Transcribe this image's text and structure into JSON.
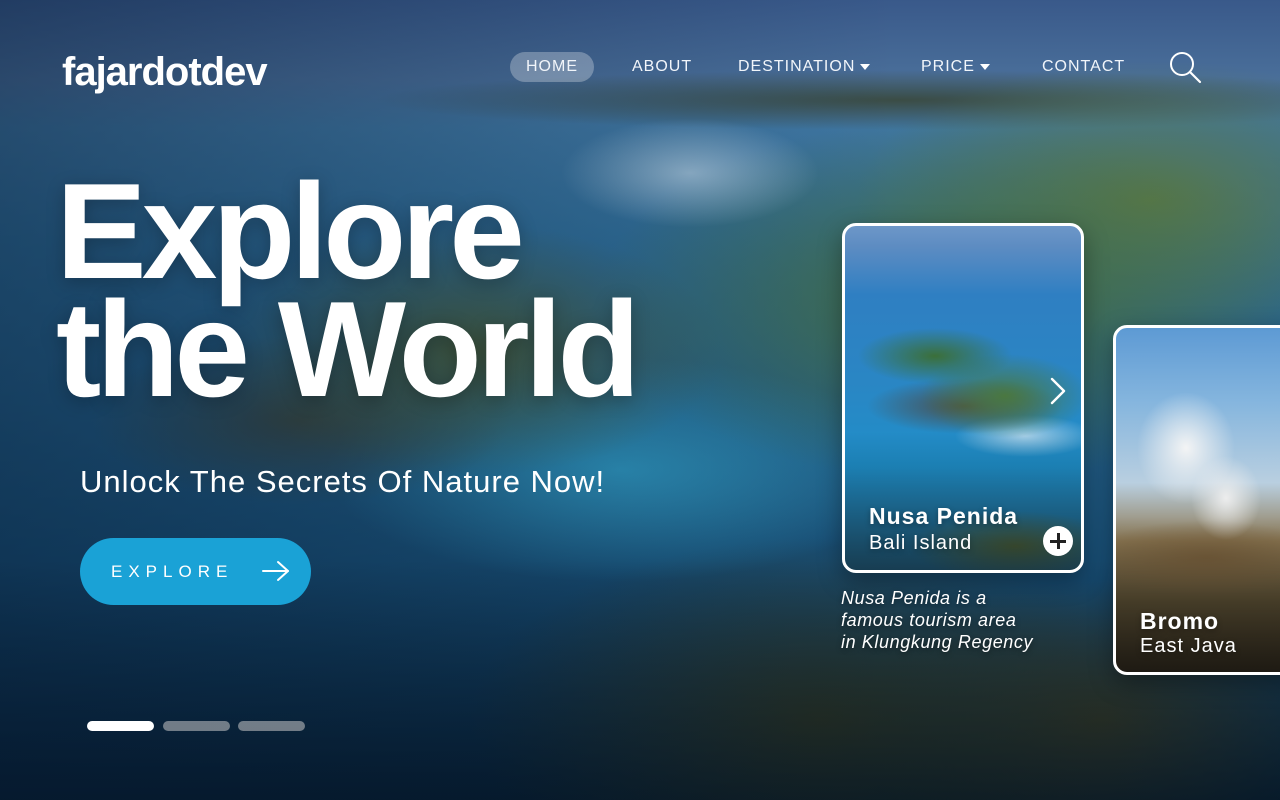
{
  "brand": {
    "logo": "fajardotdev"
  },
  "nav": {
    "items": [
      {
        "label": "HOME",
        "active": true
      },
      {
        "label": "ABOUT"
      },
      {
        "label": "DESTINATION",
        "dropdown": true
      },
      {
        "label": "PRICE",
        "dropdown": true
      },
      {
        "label": "CONTACT"
      }
    ],
    "search_icon": "search-icon"
  },
  "hero": {
    "headline_line1": "Explore",
    "headline_line2": "the World",
    "subtitle": "Unlock The Secrets Of Nature Now!",
    "cta_label": "EXPLORE",
    "cta_icon": "arrow-right-icon"
  },
  "carousel": {
    "total": 3,
    "active_index": 0
  },
  "cards": [
    {
      "title": "Nusa Penida",
      "subtitle": "Bali Island",
      "description_lines": [
        "Nusa Penida is a",
        "famous tourism area",
        "in Klungkung Regency"
      ],
      "icons": [
        "plus-icon",
        "chevron-right-icon"
      ]
    },
    {
      "title": "Bromo",
      "subtitle": "East Java"
    }
  ],
  "colors": {
    "accent": "#1aa2d6",
    "text": "#ffffff"
  }
}
